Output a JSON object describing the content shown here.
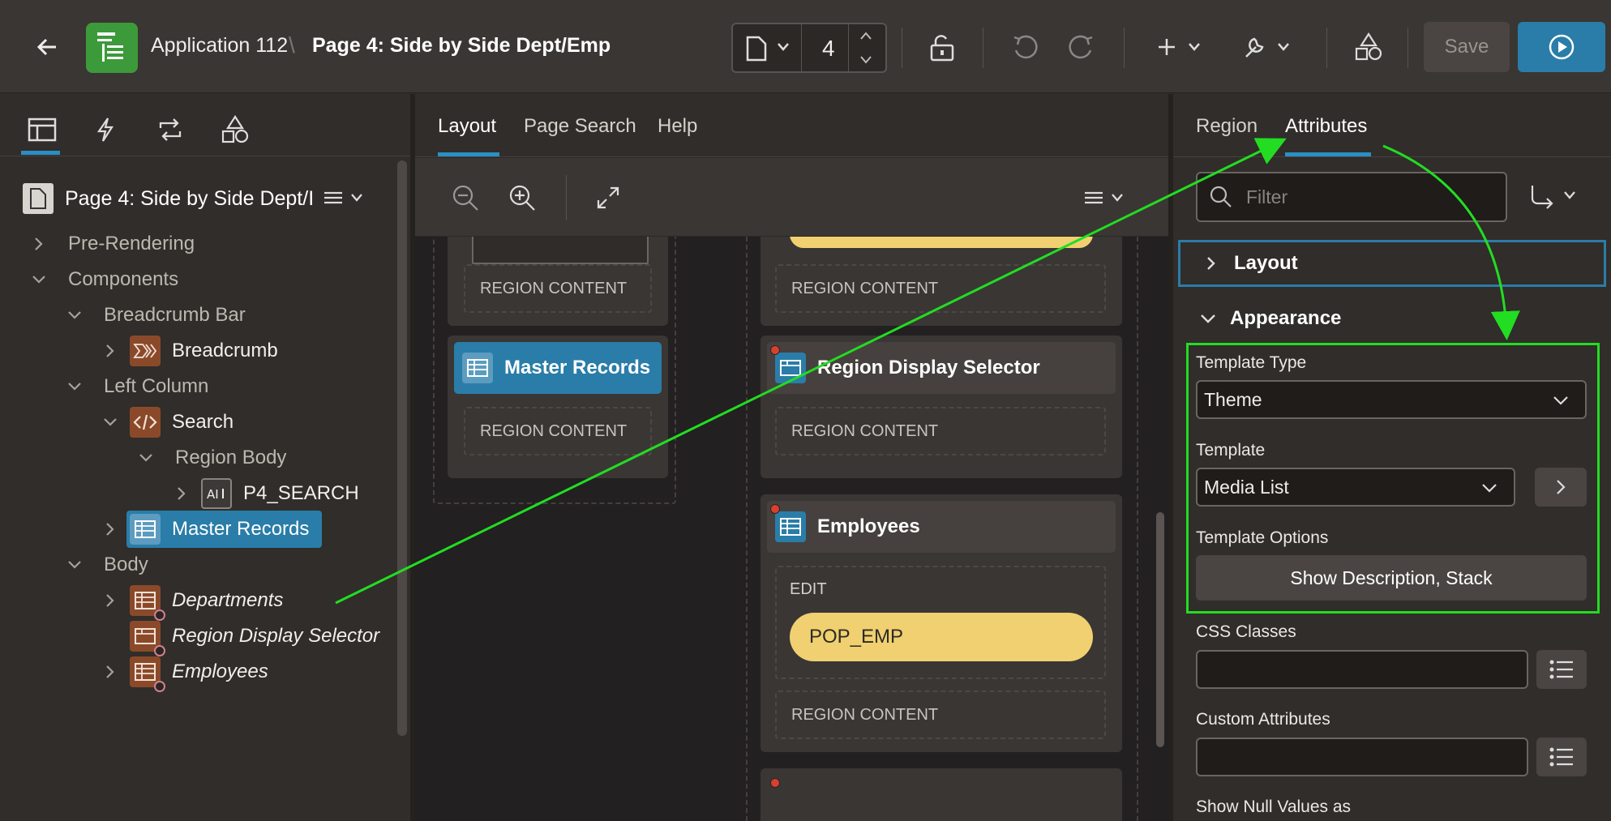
{
  "header": {
    "app_name": "Application 112",
    "separator": "\\",
    "page_title": "Page 4: Side by Side Dept/Emp",
    "page_number": "4",
    "save_label": "Save"
  },
  "left_panel": {
    "page_node": "Page 4: Side by Side Dept/I",
    "tree": [
      {
        "label": "Pre-Rendering"
      },
      {
        "label": "Components"
      },
      {
        "label": "Breadcrumb Bar"
      },
      {
        "label": "Breadcrumb"
      },
      {
        "label": "Left Column"
      },
      {
        "label": "Search"
      },
      {
        "label": "Region Body"
      },
      {
        "label": "P4_SEARCH"
      },
      {
        "label": "Master Records"
      },
      {
        "label": "Body"
      },
      {
        "label": "Departments"
      },
      {
        "label": "Region Display Selector"
      },
      {
        "label": "Employees"
      }
    ]
  },
  "middle_panel": {
    "tabs": [
      "Layout",
      "Page Search",
      "Help"
    ],
    "region_content": "REGION CONTENT",
    "regions": {
      "master_records": "Master Records",
      "region_display_selector": "Region Display Selector",
      "employees": "Employees"
    },
    "edit_label": "EDIT",
    "pop_emp": "POP_EMP"
  },
  "right_panel": {
    "tabs": [
      "Region",
      "Attributes"
    ],
    "filter_placeholder": "Filter",
    "sections": {
      "layout": "Layout",
      "appearance": "Appearance"
    },
    "template_type_label": "Template Type",
    "template_type_value": "Theme",
    "template_label": "Template",
    "template_value": "Media List",
    "template_options_label": "Template Options",
    "template_options_value": "Show Description, Stack",
    "css_classes_label": "CSS Classes",
    "custom_attributes_label": "Custom Attributes",
    "show_null_label": "Show Null Values as"
  },
  "colors": {
    "accent_blue": "#2a7da8",
    "annotation_green": "#22dd22",
    "pill_yellow": "#f0d070"
  }
}
